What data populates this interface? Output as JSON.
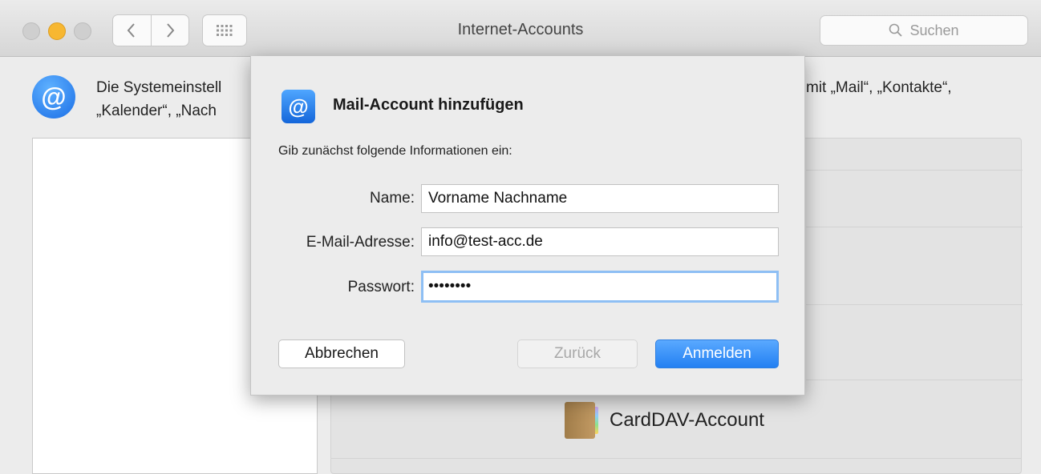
{
  "window": {
    "title": "Internet-Accounts",
    "search_placeholder": "Suchen"
  },
  "header": {
    "description_left_line1": "Die Systemeinstell",
    "description_left_line2": "„Kalender“, „Nach",
    "description_right_line1": "mit „Mail“, „Kontakte“,"
  },
  "account_list": {
    "carddav_label": "CardDAV-Account"
  },
  "dialog": {
    "title": "Mail-Account hinzufügen",
    "subtitle": "Gib zunächst folgende Informationen ein:",
    "name_label": "Name:",
    "name_value": "Vorname Nachname",
    "email_label": "E-Mail-Adresse:",
    "email_value": "info@test-acc.de",
    "password_label": "Passwort:",
    "password_value": "••••••••",
    "cancel_label": "Abbrechen",
    "back_label": "Zurück",
    "login_label": "Anmelden"
  },
  "colors": {
    "accent": "#2380f2",
    "minimize": "#f7b731"
  }
}
